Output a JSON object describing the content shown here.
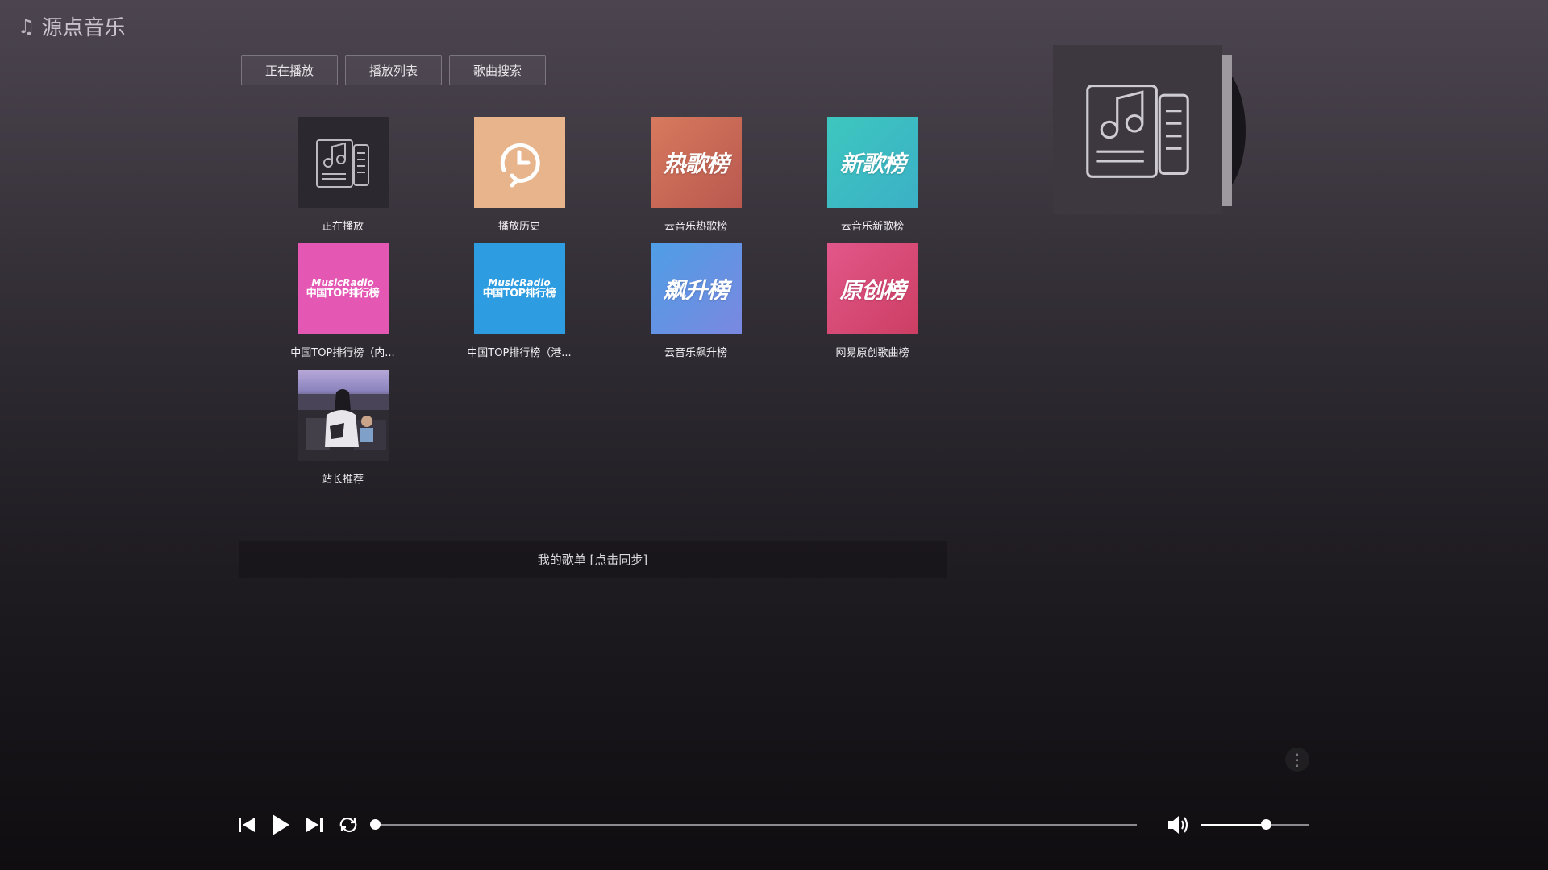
{
  "app": {
    "title": "源点音乐"
  },
  "tabs": [
    {
      "label": "正在播放"
    },
    {
      "label": "播放列表"
    },
    {
      "label": "歌曲搜索"
    }
  ],
  "cards": [
    {
      "label": "正在播放",
      "cover_text": ""
    },
    {
      "label": "播放历史",
      "cover_text": ""
    },
    {
      "label": "云音乐热歌榜",
      "cover_text": "热歌榜"
    },
    {
      "label": "云音乐新歌榜",
      "cover_text": "新歌榜"
    },
    {
      "label": "中国TOP排行榜（内...",
      "cover_text": "MusicRadio",
      "cover_sub": "中国TOP排行榜"
    },
    {
      "label": "中国TOP排行榜（港...",
      "cover_text": "MusicRadio",
      "cover_sub": "中国TOP排行榜"
    },
    {
      "label": "云音乐飙升榜",
      "cover_text": "飙升榜"
    },
    {
      "label": "网易原创歌曲榜",
      "cover_text": "原创榜"
    },
    {
      "label": "站长推荐",
      "cover_text": ""
    }
  ],
  "playlist": {
    "label": "我的歌单 [点击同步]"
  },
  "player": {
    "progress_fraction": 0.0,
    "volume_fraction": 0.6
  },
  "colors": {
    "history": "#e8b48c",
    "hot": "#c9655a",
    "new": "#3fbcc0",
    "top_mainland": "#e458b4",
    "top_hk": "#2e9ce0",
    "rising": "#5e92e3",
    "original": "#d84a72"
  }
}
